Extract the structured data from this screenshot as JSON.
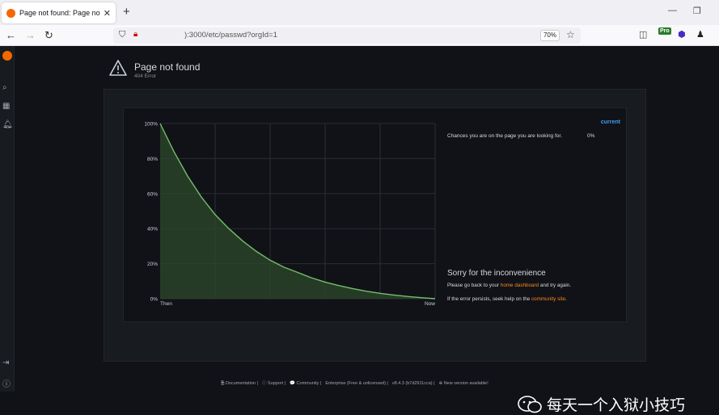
{
  "browser": {
    "tab_title": "Page not found: Page not found",
    "tab_close": "✕",
    "new_tab": "+",
    "minimize": "—",
    "restore": "❐",
    "url": "):3000/etc/passwd?orgId=1",
    "zoom": "70%"
  },
  "icons": {
    "back": "back-arrow-icon",
    "forward": "forward-arrow-icon",
    "reload": "reload-icon",
    "shield": "shield-icon",
    "lock": "insecure-lock-icon",
    "star": "bookmark-star-icon",
    "pocket": "pocket-icon",
    "ext_pro": "Pro",
    "ext2": "extension-hex-icon",
    "ext3": "extension-person-icon"
  },
  "grafana": {
    "title": "Page not found",
    "subtitle": "404 Error",
    "current_label": "current",
    "chance_text": "Chances you are on the page you are looking for.",
    "chance_value": "0%",
    "sorry_title": "Sorry for the inconvenience",
    "go_back_prefix": "Please go back to your",
    "home_link": "home dashboard",
    "go_back_suffix": "and try again.",
    "persist_prefix": "If the error persists, seek help on the",
    "community_link": "community site",
    "persist_suffix": "."
  },
  "chart_data": {
    "type": "area",
    "x_labels": [
      "Then",
      "Now"
    ],
    "y_ticks": [
      "100%",
      "80%",
      "60%",
      "40%",
      "20%",
      "0%"
    ],
    "ylim": [
      0,
      100
    ],
    "grid": true,
    "series": [
      {
        "values": [
          100,
          84,
          70,
          58,
          48,
          40,
          33,
          27,
          22,
          18,
          15,
          12,
          9.5,
          7.5,
          5.8,
          4.3,
          3.1,
          2.1,
          1.3,
          0.6,
          0
        ]
      }
    ],
    "colors": {
      "line": "#73bf69",
      "fill": "#2e4a2b"
    }
  },
  "footer": {
    "items": [
      "Documentation",
      "Support",
      "Community",
      "Enterprise (Free & unlicensed)",
      "v8.4.3 (b7d2911cca)",
      "New version available!"
    ]
  },
  "watermark": {
    "text": "每天一个入狱小技巧"
  }
}
